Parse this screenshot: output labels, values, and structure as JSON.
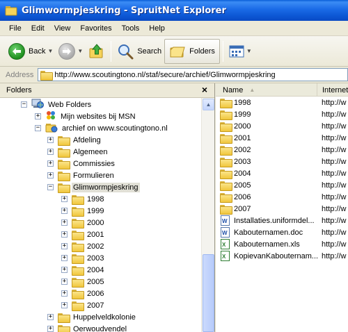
{
  "window": {
    "title": "Glimwormpjeskring - SpruitNet Explorer"
  },
  "menu": [
    "File",
    "Edit",
    "View",
    "Favorites",
    "Tools",
    "Help"
  ],
  "toolbar": {
    "back": "Back",
    "search": "Search",
    "folders": "Folders"
  },
  "address": {
    "label": "Address",
    "url": "http://www.scoutingtono.nl/staf/secure/archief/Glimwormpjeskring"
  },
  "folders_pane": {
    "title": "Folders",
    "close": "×",
    "tree": [
      {
        "label": "Web Folders",
        "icon": "web-folders-icon",
        "expander": "−"
      },
      {
        "label": "Mijn websites bij MSN",
        "icon": "msn-icon",
        "expander": "+"
      },
      {
        "label": "archief on www.scoutingtono.nl",
        "icon": "web-folder-icon",
        "expander": "−"
      },
      {
        "label": "Afdeling",
        "expander": "+"
      },
      {
        "label": "Algemeen",
        "expander": "+"
      },
      {
        "label": "Commissies",
        "expander": "+"
      },
      {
        "label": "Formulieren",
        "expander": "+"
      },
      {
        "label": "Glimwormpjeskring",
        "expander": "−",
        "selected": true
      },
      {
        "label": "1998",
        "expander": "+"
      },
      {
        "label": "1999",
        "expander": "+"
      },
      {
        "label": "2000",
        "expander": "+"
      },
      {
        "label": "2001",
        "expander": "+"
      },
      {
        "label": "2002",
        "expander": "+"
      },
      {
        "label": "2003",
        "expander": "+"
      },
      {
        "label": "2004",
        "expander": "+"
      },
      {
        "label": "2005",
        "expander": "+"
      },
      {
        "label": "2006",
        "expander": "+"
      },
      {
        "label": "2007",
        "expander": "+"
      },
      {
        "label": "Huppelveldkolonie",
        "expander": "+"
      },
      {
        "label": "Oerwoudvendel",
        "expander": "+"
      }
    ]
  },
  "file_list": {
    "columns": [
      "Name",
      "Internet"
    ],
    "rows": [
      {
        "name": "1998",
        "type": "folder",
        "address": "http://w"
      },
      {
        "name": "1999",
        "type": "folder",
        "address": "http://w"
      },
      {
        "name": "2000",
        "type": "folder",
        "address": "http://w"
      },
      {
        "name": "2001",
        "type": "folder",
        "address": "http://w"
      },
      {
        "name": "2002",
        "type": "folder",
        "address": "http://w"
      },
      {
        "name": "2003",
        "type": "folder",
        "address": "http://w"
      },
      {
        "name": "2004",
        "type": "folder",
        "address": "http://w"
      },
      {
        "name": "2005",
        "type": "folder",
        "address": "http://w"
      },
      {
        "name": "2006",
        "type": "folder",
        "address": "http://w"
      },
      {
        "name": "2007",
        "type": "folder",
        "address": "http://w"
      },
      {
        "name": "Installaties.uniformdel...",
        "type": "doc",
        "address": "http://w"
      },
      {
        "name": "Kabouternamen.doc",
        "type": "doc",
        "address": "http://w"
      },
      {
        "name": "Kabouternamen.xls",
        "type": "xls",
        "address": "http://w"
      },
      {
        "name": "KopievanKabouternam...",
        "type": "xls",
        "address": "http://w"
      }
    ]
  }
}
